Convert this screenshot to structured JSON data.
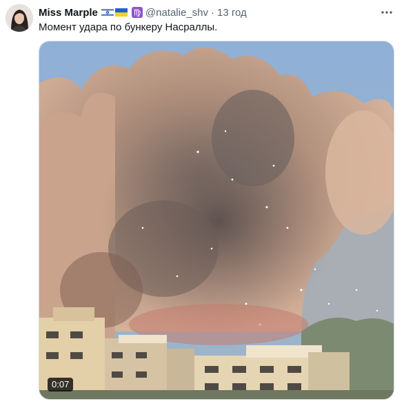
{
  "tweet": {
    "author": {
      "name": "Miss Marple",
      "handle": "@natalie_shv",
      "avatar": "avatar-photo"
    },
    "badges": [
      "israel-flag-icon",
      "ukraine-flag-icon",
      "virgo-zodiac-icon"
    ],
    "separator": "·",
    "time": "13 год",
    "text": "Момент удара по бункеру Насраллы.",
    "media": {
      "type": "video",
      "description": "explosion-video-thumbnail",
      "duration": "0:07"
    },
    "more_icon": "more-horizontal-icon"
  },
  "colors": {
    "text_primary": "#0f1419",
    "text_secondary": "#536471",
    "border": "#cfd9de",
    "zodiac_badge": "#8e55c9"
  }
}
